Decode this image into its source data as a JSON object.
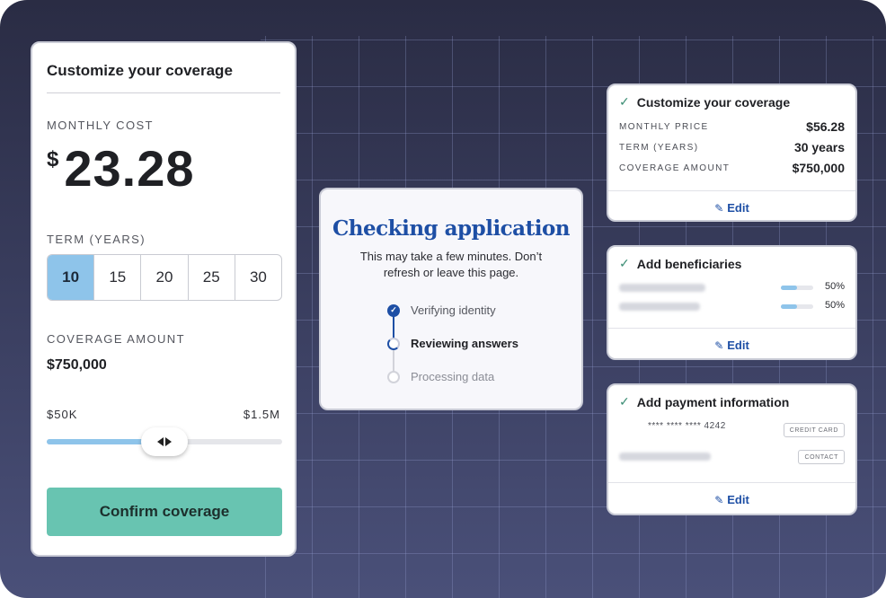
{
  "left": {
    "title": "Customize your coverage",
    "monthly_cost_label": "MONTHLY COST",
    "currency_symbol": "$",
    "monthly_cost_value": "23.28",
    "term_label": "TERM (YEARS)",
    "term_options": [
      "10",
      "15",
      "20",
      "25",
      "30"
    ],
    "term_selected": "10",
    "coverage_label": "COVERAGE AMOUNT",
    "coverage_value": "$750,000",
    "range_min": "$50K",
    "range_max": "$1.5M",
    "slider_fraction": 0.5,
    "confirm_label": "Confirm coverage",
    "accent_color": "#8ec4ea",
    "confirm_color": "#68c4b1"
  },
  "checking": {
    "heading": "Checking application",
    "subtitle": "This may take a few minutes. Don’t refresh or leave this page.",
    "steps": [
      {
        "label": "Verifying identity",
        "state": "done"
      },
      {
        "label": "Reviewing answers",
        "state": "active"
      },
      {
        "label": "Processing data",
        "state": "pending"
      }
    ],
    "heading_color": "#1e4fa5"
  },
  "summary_coverage": {
    "title": "Customize your coverage",
    "rows": [
      {
        "key": "MONTHLY PRICE",
        "value": "$56.28"
      },
      {
        "key": "TERM (YEARS)",
        "value": "30 years"
      },
      {
        "key": "COVERAGE AMOUNT",
        "value": "$750,000"
      }
    ],
    "edit_label": "Edit"
  },
  "summary_beneficiaries": {
    "title": "Add beneficiaries",
    "beneficiaries": [
      {
        "share_label": "50%",
        "share": 0.5
      },
      {
        "share_label": "50%",
        "share": 0.5
      }
    ],
    "edit_label": "Edit"
  },
  "summary_payment": {
    "title": "Add payment information",
    "card_number": "**** **** **** 4242",
    "card_tag": "CREDIT CARD",
    "contact_tag": "CONTACT",
    "edit_label": "Edit"
  },
  "icons": {
    "check": "check-icon",
    "pencil": "pencil-icon",
    "slider_arrows": "left-right-arrows-icon"
  }
}
